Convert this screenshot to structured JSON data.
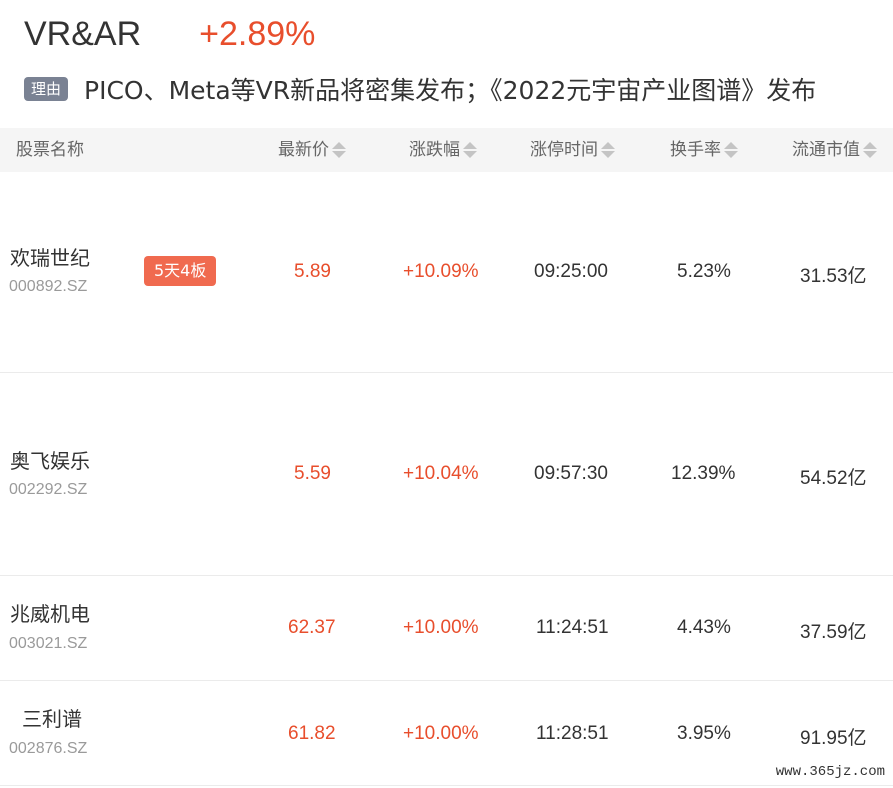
{
  "sector": {
    "name": "VR&AR",
    "change": "+2.89%"
  },
  "reason": {
    "badge": "理由",
    "text": "PICO、Meta等VR新品将密集发布；《2022元宇宙产业图谱》发布"
  },
  "table": {
    "headers": {
      "name": "股票名称",
      "price": "最新价",
      "change": "涨跌幅",
      "limit_time": "涨停时间",
      "turnover": "换手率",
      "market_cap": "流通市值"
    },
    "rows": [
      {
        "name": "欢瑞世纪",
        "code": "000892.SZ",
        "badge": "5天4板",
        "price": "5.89",
        "change": "+10.09%",
        "limit_time": "09:25:00",
        "turnover": "5.23%",
        "market_cap": "31.53亿"
      },
      {
        "name": "奥飞娱乐",
        "code": "002292.SZ",
        "badge": "",
        "price": "5.59",
        "change": "+10.04%",
        "limit_time": "09:57:30",
        "turnover": "12.39%",
        "market_cap": "54.52亿"
      },
      {
        "name": "兆威机电",
        "code": "003021.SZ",
        "badge": "",
        "price": "62.37",
        "change": "+10.00%",
        "limit_time": "11:24:51",
        "turnover": "4.43%",
        "market_cap": "37.59亿"
      },
      {
        "name": "三利谱",
        "code": "002876.SZ",
        "badge": "",
        "price": "61.82",
        "change": "+10.00%",
        "limit_time": "11:28:51",
        "turnover": "3.95%",
        "market_cap": "91.95亿"
      }
    ]
  },
  "watermark": "www.365jz.com",
  "colors": {
    "up": "#e84e2c",
    "badge_board": "#f06a4f",
    "badge_reason": "#7a8293",
    "header_bg": "#f5f5f5"
  }
}
